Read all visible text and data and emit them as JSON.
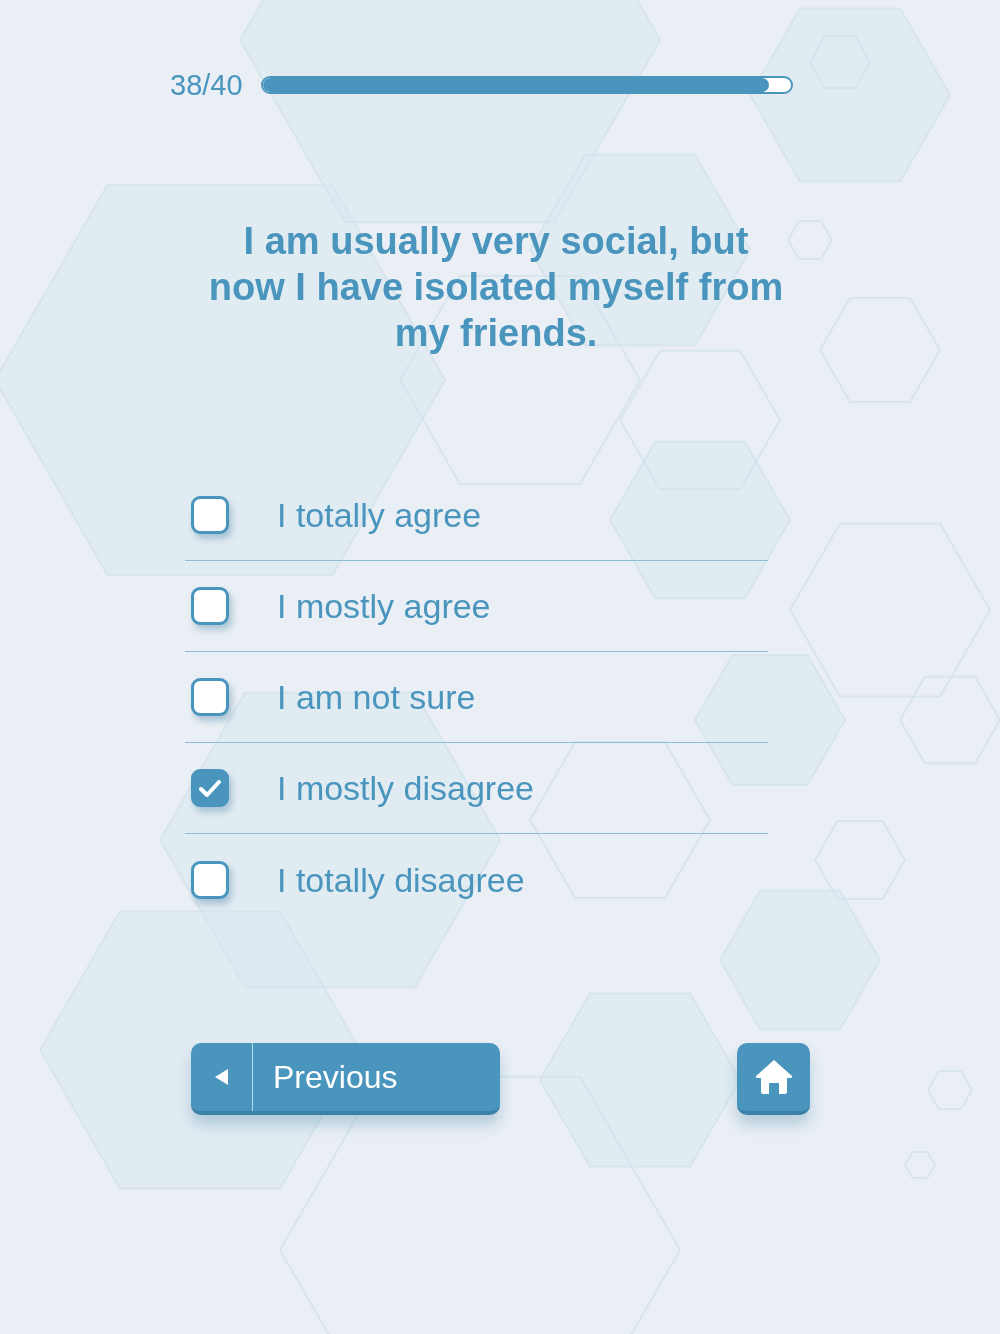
{
  "progress": {
    "label": "38/40",
    "level": 0.96
  },
  "question": "I am usually very social, but now I have isolated myself from my friends.",
  "options": [
    {
      "label": "I totally agree",
      "checked": false
    },
    {
      "label": "I mostly agree",
      "checked": false
    },
    {
      "label": "I am not sure",
      "checked": false
    },
    {
      "label": "I mostly disagree",
      "checked": true
    },
    {
      "label": "I totally disagree",
      "checked": false
    }
  ],
  "previous_button": {
    "label": "Previous"
  }
}
